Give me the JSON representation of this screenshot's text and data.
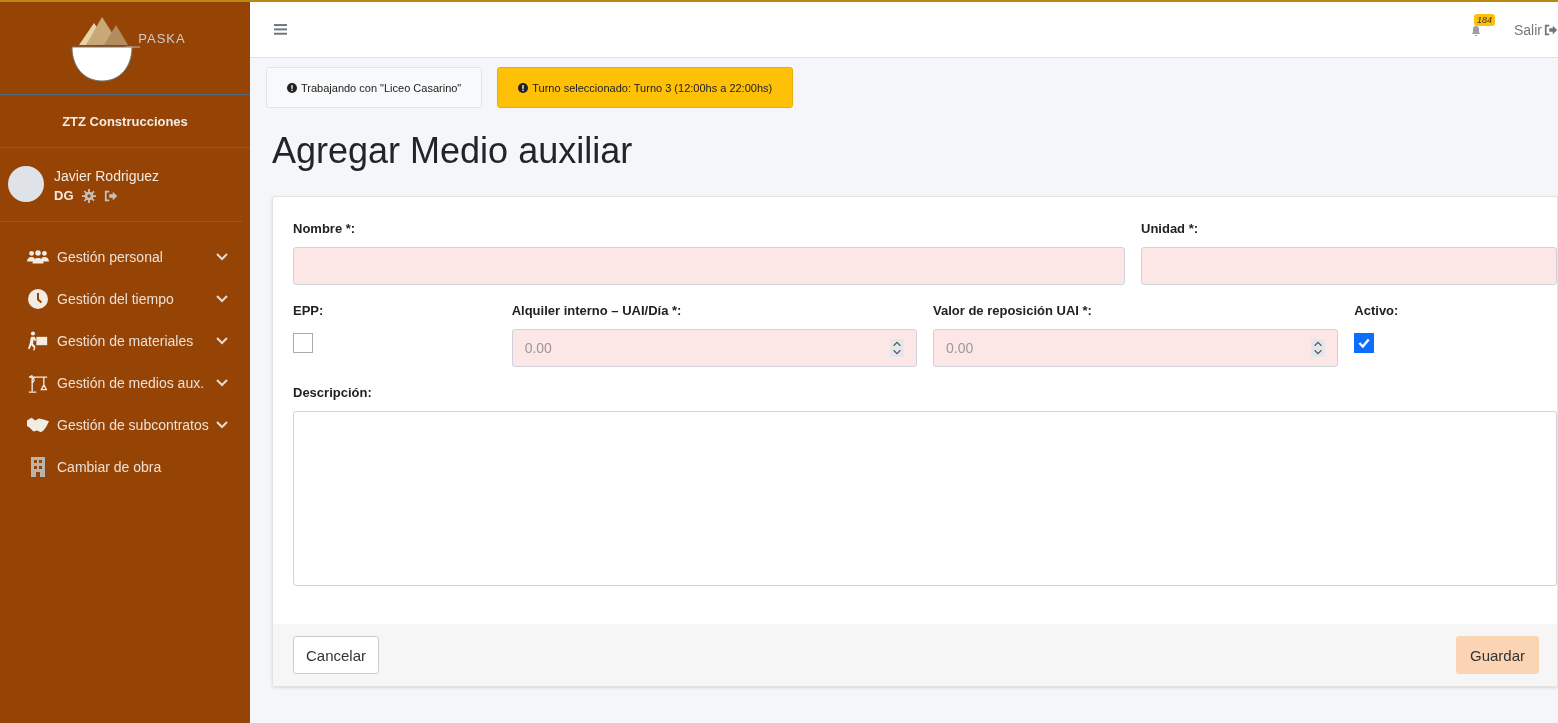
{
  "sidebar": {
    "logo_text": "PASKA",
    "company": "ZTZ Construcciones",
    "user": {
      "name": "Javier Rodriguez",
      "role": "DG"
    },
    "items": [
      {
        "label": "Gestión personal",
        "expandable": true
      },
      {
        "label": "Gestión del tiempo",
        "expandable": true
      },
      {
        "label": "Gestión de materiales",
        "expandable": true
      },
      {
        "label": "Gestión de medios aux.",
        "expandable": true
      },
      {
        "label": "Gestión de subcontratos",
        "expandable": true
      },
      {
        "label": "Cambiar de obra",
        "expandable": false
      }
    ]
  },
  "topbar": {
    "notifications": "184",
    "logout": "Salir"
  },
  "alerts": [
    {
      "text": "Trabajando con \"Liceo Casarino\"",
      "kind": "light"
    },
    {
      "text": "Turno seleccionado: Turno 3 (12:00hs a 22:00hs)",
      "kind": "warning"
    }
  ],
  "page_title": "Agregar Medio auxiliar",
  "form": {
    "rows": [
      [
        {
          "label": "Nombre *:",
          "kind": "text",
          "invalid": true
        },
        {
          "label": "Unidad *:",
          "kind": "text",
          "invalid": true
        }
      ],
      [
        {
          "label": "EPP:",
          "kind": "checkbox",
          "checked": false
        },
        {
          "label": "Alquiler interno – UAI/Día *:",
          "kind": "number",
          "placeholder": "0.00",
          "invalid": true
        },
        {
          "label": "Valor de reposición UAI *:",
          "kind": "number",
          "placeholder": "0.00",
          "invalid": true
        },
        {
          "label": "Activo:",
          "kind": "checkbox",
          "checked": true
        }
      ],
      [
        {
          "label": "Descripción:",
          "kind": "textarea",
          "invalid": false
        }
      ]
    ],
    "buttons": [
      {
        "label": "Cancelar",
        "kind": "secondary"
      },
      {
        "label": "Guardar",
        "kind": "primary"
      }
    ]
  }
}
